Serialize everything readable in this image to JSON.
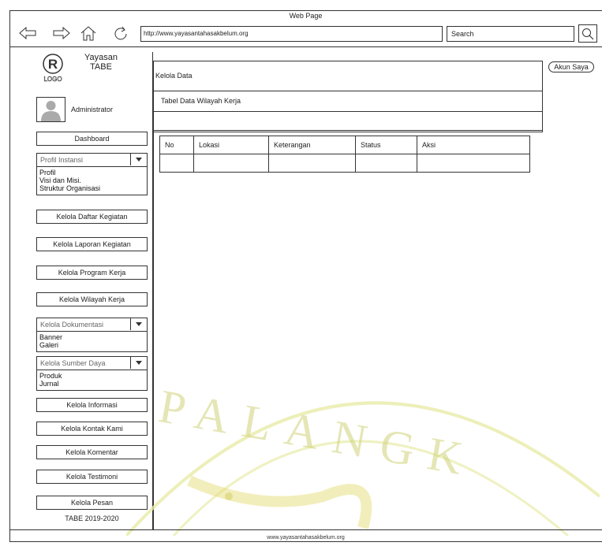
{
  "window": {
    "title": "Web Page"
  },
  "browser": {
    "url": "http://www.yayasantahasakbelum.org",
    "search_placeholder": "Search"
  },
  "brand": {
    "line1": "Yayasan",
    "line2": "TABE",
    "logo_letter": "R",
    "logo_sub": "LOGO"
  },
  "user": {
    "role": "Administrator"
  },
  "sidebar": {
    "dashboard": "Dashboard",
    "profil_dropdown": {
      "label": "Profil Instansi",
      "options": [
        "Profil",
        "Visi dan Misi.",
        "Struktur Organisasi"
      ]
    },
    "kelola_daftar": "Kelola Daftar Kegiatan",
    "kelola_laporan": "Kelola Laporan Kegiatan",
    "kelola_program": "Kelola Program Kerja",
    "kelola_wilayah": "Kelola Wilayah Kerja",
    "dokumentasi_dropdown": {
      "label": "Kelola Dokumentasi",
      "options": [
        "Banner",
        "Galeri"
      ]
    },
    "sumberdaya_dropdown": {
      "label": "Kelola Sumber Daya",
      "options": [
        "Produk",
        "Jurnal"
      ]
    },
    "kelola_informasi": "Kelola Informasi",
    "kelola_kontak": "Kelola Kontak Kami",
    "kelola_komentar": "Kelola Komentar",
    "kelola_testimoni": "Kelola Testimoni",
    "kelola_pesan": "Kelola Pesan",
    "copyright": "TABE 2019-2020"
  },
  "header": {
    "akun": "Akun Saya"
  },
  "main": {
    "title": "Kelola Data",
    "subtitle": "Tabel Data Wilayah Kerja",
    "table": {
      "columns": [
        "No",
        "Lokasi",
        "Keterangan",
        "Status",
        "Aksi"
      ]
    }
  },
  "footer": {
    "text": "www.yayasantahasakbelum.org"
  },
  "watermark": {
    "text": "PALANGK"
  }
}
